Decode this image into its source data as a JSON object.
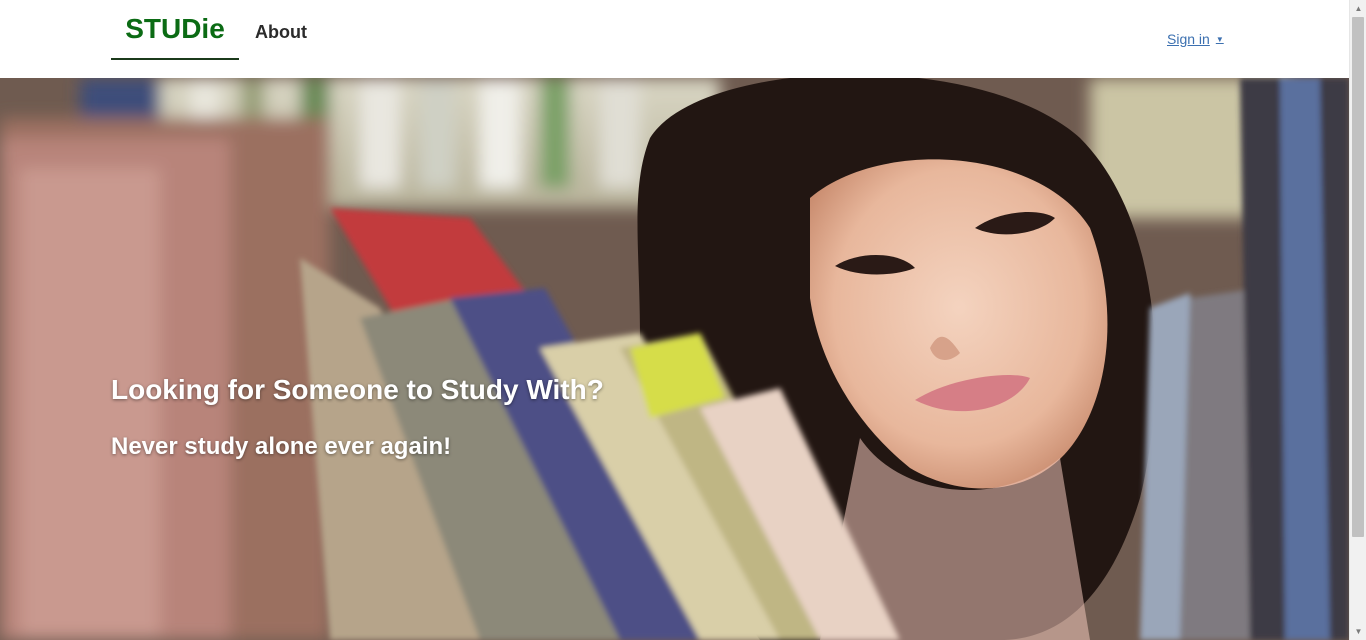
{
  "nav": {
    "brand": "STUDie",
    "about": "About",
    "signin": "Sign in",
    "signin_caret_icon": "caret-down-icon"
  },
  "hero": {
    "title": "Looking for Someone to Study With?",
    "subtitle": "Never study alone ever again!",
    "background": "photo-girl-reading-library-books"
  },
  "colors": {
    "brand": "#0b6b14",
    "link": "#3c70b0",
    "hero_text": "#ffffff"
  }
}
